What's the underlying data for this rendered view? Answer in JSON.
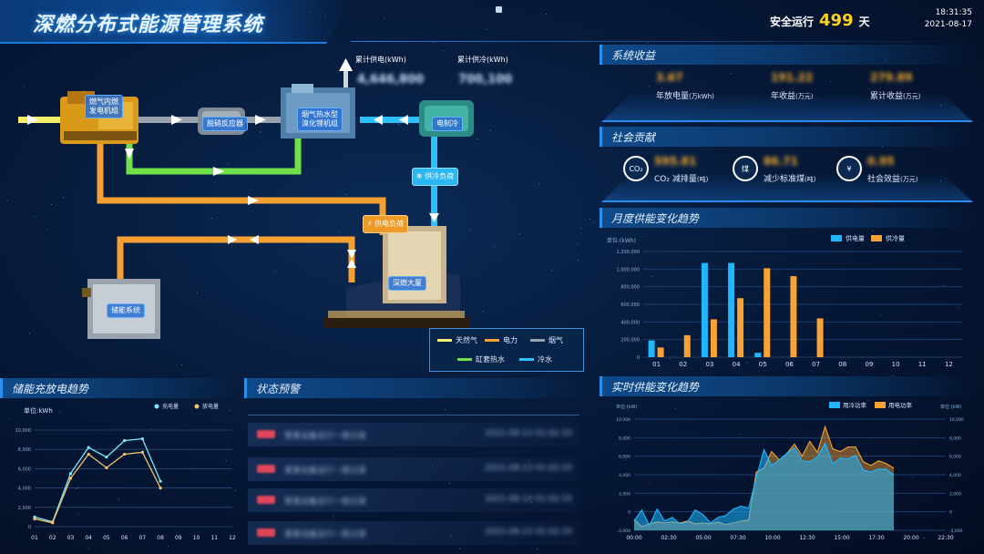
{
  "header": {
    "title": "深燃分布式能源管理系统",
    "safe_run_label": "安全运行",
    "safe_run_days": "499",
    "safe_run_unit": "天",
    "time": "18:31:35",
    "date": "2021-08-17"
  },
  "diagram": {
    "cumulative_power_label": "累计供电(kWh)",
    "cumulative_cooling_label": "累计供冷(kWh)",
    "cumulative_power_value": "4,646,800",
    "cumulative_cooling_value": "700,100",
    "nodes": {
      "gas_engine": "燃气内燃\n发电机组",
      "desulfurizer": "脱硝反应器",
      "absorption_chiller": "烟气热水型\n溴化锂机组",
      "electric_chiller": "电制冷",
      "cooling_load": "供冷负荷",
      "power_load": "供电负荷",
      "building": "深燃大厦",
      "storage": "储能系统"
    },
    "legend": [
      {
        "label": "天然气",
        "color": "#f6ef6a"
      },
      {
        "label": "电力",
        "color": "#f5a031"
      },
      {
        "label": "烟气",
        "color": "#9aa3ad"
      },
      {
        "label": "缸套热水",
        "color": "#6fe04a"
      },
      {
        "label": "冷水",
        "color": "#2cc0ff"
      }
    ]
  },
  "system_income": {
    "title": "系统收益",
    "items": [
      {
        "value": "3.67",
        "label": "年放电量",
        "unit": "(万kWh)"
      },
      {
        "value": "191.22",
        "label": "年收益",
        "unit": "(万元)"
      },
      {
        "value": "279.89",
        "label": "累计收益",
        "unit": "(万元)"
      }
    ]
  },
  "social_contribution": {
    "title": "社会贡献",
    "items": [
      {
        "icon": "co2-icon",
        "icon_text": "CO₂",
        "value": "595.81",
        "label": "CO₂ 减排量",
        "unit": "(吨)"
      },
      {
        "icon": "coal-icon",
        "icon_text": "煤",
        "value": "86.71",
        "label": "减少标准煤",
        "unit": "(吨)"
      },
      {
        "icon": "coins-icon",
        "icon_text": "¥",
        "value": "0.95",
        "label": "社会效益",
        "unit": "(万元)"
      }
    ]
  },
  "monthly_chart_panel": {
    "title": "月度供能变化趋势"
  },
  "storage_chart_panel": {
    "title": "储能充放电趋势"
  },
  "alert_panel": {
    "title": "状态预警",
    "rows": [
      {
        "text": "某某设备运行一般记录",
        "time": "2021-08-13 01:02:33"
      },
      {
        "text": "某某设备运行一般记录",
        "time": "2021-08-13 01:02:33"
      },
      {
        "text": "某某设备运行一般记录",
        "time": "2021-08-13 01:02:33"
      },
      {
        "text": "某某设备运行一般记录",
        "time": "2021-08-13 01:02:33"
      }
    ]
  },
  "realtime_chart_panel": {
    "title": "实时供能变化趋势"
  },
  "chart_data": [
    {
      "type": "bar",
      "title": "",
      "ylabel": "单位:(kWh)",
      "categories": [
        "01",
        "02",
        "03",
        "04",
        "05",
        "06",
        "07",
        "08",
        "09",
        "10",
        "11",
        "12"
      ],
      "ylim": [
        0,
        1200000
      ],
      "yticks": [
        "0",
        "200,000",
        "400,000",
        "600,000",
        "800,000",
        "1,000,000",
        "1,200,000"
      ],
      "legend_position": "top-right",
      "series": [
        {
          "name": "供电量",
          "color": "#1fb6ff",
          "values": [
            190000,
            0,
            1070000,
            1070000,
            50000,
            0,
            0,
            0,
            0,
            0,
            0,
            0
          ]
        },
        {
          "name": "供冷量",
          "color": "#f7a233",
          "values": [
            110000,
            250000,
            430000,
            670000,
            1010000,
            920000,
            440000,
            0,
            0,
            0,
            0,
            0
          ]
        }
      ]
    },
    {
      "type": "line",
      "title": "",
      "ylabel": "单位:kWh",
      "categories": [
        "01",
        "02",
        "03",
        "04",
        "05",
        "06",
        "07",
        "08",
        "09",
        "10",
        "11",
        "12"
      ],
      "ylim": [
        0,
        10000
      ],
      "yticks": [
        "0",
        "2,000",
        "4,000",
        "6,000",
        "8,000",
        "10,000"
      ],
      "legend_position": "top-right",
      "series": [
        {
          "name": "充电量",
          "color": "#7ee7ff",
          "values": [
            1000,
            500,
            5500,
            8200,
            7200,
            8900,
            9100,
            4700
          ]
        },
        {
          "name": "放电量",
          "color": "#f3c26a",
          "values": [
            800,
            400,
            5000,
            7500,
            6100,
            7500,
            7700,
            4000
          ]
        }
      ]
    },
    {
      "type": "area",
      "title": "",
      "xticks": [
        "00:00",
        "02:30",
        "05:00",
        "07:30",
        "10:00",
        "12:30",
        "15:00",
        "17:30",
        "20:00",
        "22:30"
      ],
      "ylabel_left": "单位:(kW)",
      "ylabel_right": "单位:(kW)",
      "ylim": [
        -2000,
        10000
      ],
      "yticks": [
        "-2,000",
        "0",
        "2,000",
        "4,000",
        "6,000",
        "8,000",
        "10,000"
      ],
      "legend_position": "top-right",
      "series": [
        {
          "name": "用冷功率",
          "color": "#1fb6ff",
          "values": [
            -1000,
            200,
            -1500,
            300,
            -1000,
            -600,
            -1300,
            -1100,
            200,
            -300,
            -1200,
            -600,
            -400,
            300,
            600,
            400,
            3700,
            6700,
            5000,
            5600,
            6300,
            6900,
            5500,
            5400,
            5900,
            7400,
            5200,
            5800,
            5700,
            6100,
            4500,
            4300,
            4600,
            4600,
            4000
          ]
        },
        {
          "name": "用电功率",
          "color": "#f7a233",
          "values": [
            -800,
            -1600,
            -1300,
            -1100,
            -1200,
            -1100,
            -1200,
            -1000,
            -1300,
            -1200,
            -1300,
            -1100,
            -1400,
            -1200,
            -1000,
            -900,
            4300,
            4700,
            6500,
            5600,
            6300,
            7300,
            6000,
            7600,
            6400,
            9200,
            6800,
            6500,
            7000,
            7000,
            5400,
            5000,
            5500,
            5200,
            4700
          ]
        }
      ]
    }
  ]
}
